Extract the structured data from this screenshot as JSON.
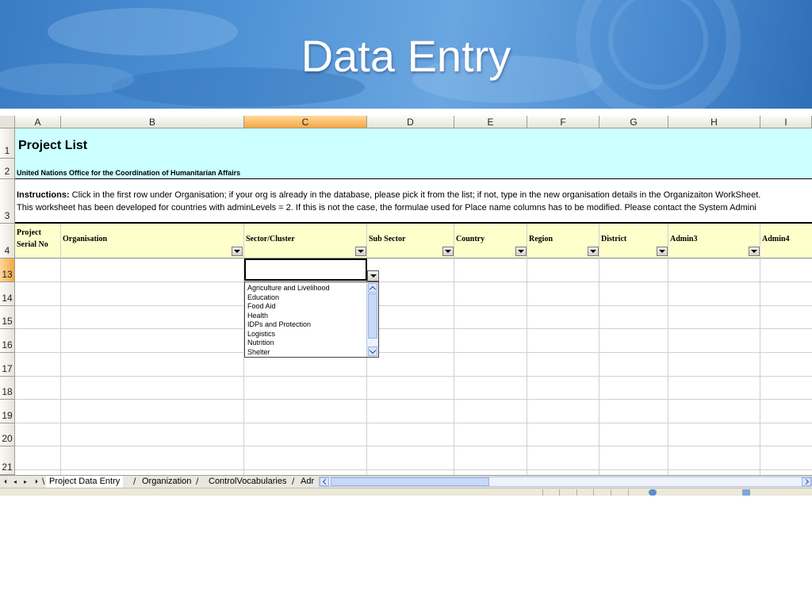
{
  "slide": {
    "title": "Data Entry"
  },
  "spreadsheet": {
    "columns": [
      "A",
      "B",
      "C",
      "D",
      "E",
      "F",
      "G",
      "H",
      "I"
    ],
    "selected_column": "C",
    "rows": [
      "1",
      "2",
      "3",
      "4",
      "13",
      "14",
      "15",
      "16",
      "17",
      "18",
      "19",
      "20",
      "21"
    ],
    "selected_row": "13",
    "title": "Project List",
    "organisation_line": "United Nations Office for the Coordination of Humanitarian Affairs",
    "instructions": {
      "label": "Instructions:",
      "line1": " Click in the first row under Organisation; if your org is already in the database, please pick it from the list; if not, type in the new organisation details in the Organizaiton WorkSheet.",
      "line2": "This worksheet has been developed for countries with adminLevels = 2.  If this is not the case, the formulae used for Place name columns has to be modified.  Please contact the System Admini"
    },
    "headers": {
      "project_serial": "Project Serial No",
      "organisation": "Organisation",
      "sector": "Sector/Cluster",
      "sub_sector": "Sub Sector",
      "country": "Country",
      "region": "Region",
      "district": "District",
      "admin3": "Admin3",
      "admin4": "Admin4"
    },
    "dropdown_options": [
      "Agriculture and Livelihood",
      "Education",
      "Food Aid",
      "Health",
      "IDPs and Protection",
      "Logistics",
      "Nutrition",
      "Shelter"
    ],
    "tabs": [
      "Project Data Entry",
      "Organization",
      "ControlVocabularies",
      "Adr"
    ],
    "active_tab": "Project Data Entry"
  }
}
